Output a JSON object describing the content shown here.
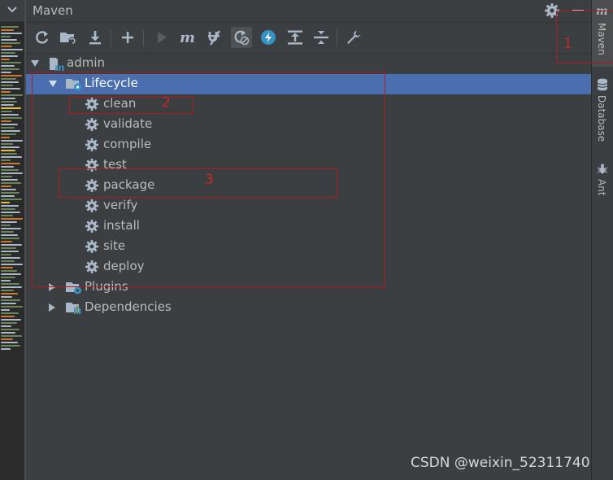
{
  "panel": {
    "title": "Maven",
    "header_icons": [
      "settings-icon",
      "minimize-icon"
    ]
  },
  "toolbar": {
    "buttons": [
      {
        "name": "reload-icon",
        "tooltip": ""
      },
      {
        "name": "generate-sources-icon",
        "tooltip": ""
      },
      {
        "name": "download-icon",
        "tooltip": ""
      },
      {
        "name": "add-icon",
        "tooltip": ""
      },
      {
        "name": "run-icon",
        "tooltip": ""
      },
      {
        "name": "maven-goal-icon",
        "tooltip": ""
      },
      {
        "name": "toggle-offline-icon",
        "tooltip": ""
      },
      {
        "name": "skip-tests-icon",
        "tooltip": ""
      },
      {
        "name": "show-dependencies-icon",
        "tooltip": ""
      },
      {
        "name": "expand-all-icon",
        "tooltip": ""
      },
      {
        "name": "collapse-all-icon",
        "tooltip": ""
      },
      {
        "name": "wrench-icon",
        "tooltip": ""
      }
    ]
  },
  "tree": {
    "project": "admin",
    "lifecycle": {
      "label": "Lifecycle",
      "goals": [
        "clean",
        "validate",
        "compile",
        "test",
        "package",
        "verify",
        "install",
        "site",
        "deploy"
      ]
    },
    "plugins": "Plugins",
    "dependencies": "Dependencies"
  },
  "side_tabs": {
    "maven": "Maven",
    "database": "Database",
    "ant": "Ant"
  },
  "annotations": {
    "one": "1",
    "two": "2",
    "three": "3"
  },
  "watermark": "CSDN @weixin_52311740",
  "colors": {
    "background": "#3c3f41",
    "selection": "#4b6eaf",
    "text": "#bbbbbb",
    "annotation": "#c62828"
  }
}
